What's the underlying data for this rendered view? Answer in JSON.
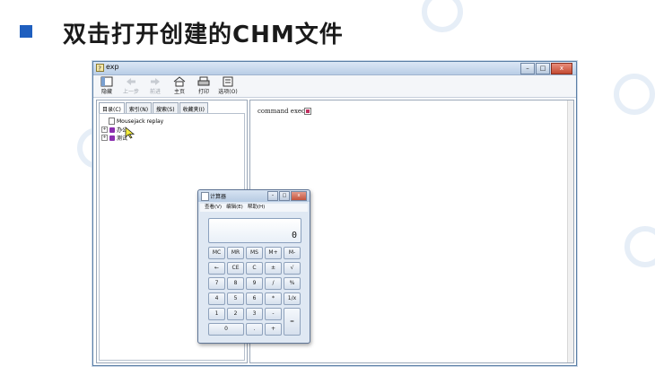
{
  "slide": {
    "title": "双击打开创建的CHM文件"
  },
  "window": {
    "title": "exp",
    "controls": {
      "minimize": "–",
      "maximize": "□",
      "close": "x"
    },
    "toolbar": [
      {
        "label": "隐藏",
        "icon": "hide-icon",
        "enabled": true
      },
      {
        "label": "上一步",
        "icon": "back-arrow-icon",
        "enabled": false
      },
      {
        "label": "前进",
        "icon": "forward-arrow-icon",
        "enabled": false
      },
      {
        "label": "主页",
        "icon": "home-icon",
        "enabled": true
      },
      {
        "label": "打印",
        "icon": "print-icon",
        "enabled": true
      },
      {
        "label": "选项(O)",
        "icon": "options-icon",
        "enabled": true
      }
    ],
    "tabs": [
      "目录(C)",
      "索引(N)",
      "搜索(S)",
      "收藏夹(I)"
    ],
    "tree": [
      {
        "label": "Mousejack replay",
        "kind": "page"
      },
      {
        "label": "办公",
        "kind": "book"
      },
      {
        "label": "测试",
        "kind": "book"
      }
    ],
    "content_text": "command exec."
  },
  "calculator": {
    "title": "计算器",
    "menu": [
      "查看(V)",
      "编辑(E)",
      "帮助(H)"
    ],
    "display": "0",
    "keys": [
      [
        "MC",
        "MR",
        "MS",
        "M+",
        "M-"
      ],
      [
        "←",
        "CE",
        "C",
        "±",
        "√"
      ],
      [
        "7",
        "8",
        "9",
        "/",
        "%"
      ],
      [
        "4",
        "5",
        "6",
        "*",
        "1/x"
      ],
      [
        "1",
        "2",
        "3",
        "-",
        "="
      ],
      [
        "0",
        ".",
        "+"
      ]
    ]
  },
  "colors": {
    "accent": "#1f5fbf",
    "book_icon": "#8b2fb0",
    "window_border": "#5b7fa6"
  }
}
